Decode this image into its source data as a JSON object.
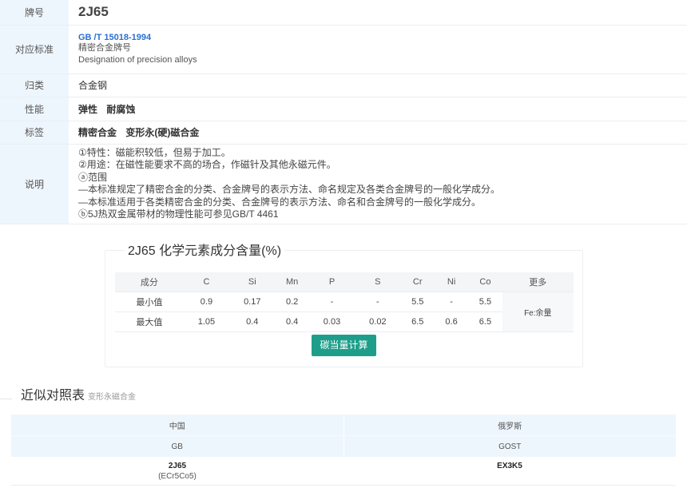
{
  "info": {
    "rows": {
      "grade": {
        "label": "牌号",
        "value": "2J65"
      },
      "standard": {
        "label": "对应标准",
        "code": "GB /T 15018-1994",
        "name_cn": "精密合金牌号",
        "name_en": "Designation of precision alloys"
      },
      "category": {
        "label": "归类",
        "value": "合金钢"
      },
      "performance": {
        "label": "性能",
        "tags": [
          "弹性",
          "耐腐蚀"
        ]
      },
      "tags": {
        "label": "标签",
        "tags": [
          "精密合金",
          "变形永(硬)磁合金"
        ]
      },
      "description": {
        "label": "说明",
        "lines": [
          "①特性：磁能积较低，但易于加工。",
          "②用途：在磁性能要求不高的场合，作磁针及其他永磁元件。",
          "ⓐ范围",
          "—本标准规定了精密合金的分类、合金牌号的表示方法、命名规定及各类合金牌号的一般化学成分。",
          "—本标准适用于各类精密合金的分类、合金牌号的表示方法、命名和合金牌号的一般化学成分。",
          "ⓑ5J热双金属带材的物理性能可参见GB/T 4461"
        ]
      }
    }
  },
  "composition": {
    "title": "2J65 化学元素成分含量(%)",
    "headers": [
      "成分",
      "C",
      "Si",
      "Mn",
      "P",
      "S",
      "Cr",
      "Ni",
      "Co",
      "更多"
    ],
    "min_row": [
      "最小值",
      "0.9",
      "0.17",
      "0.2",
      "-",
      "-",
      "5.5",
      "-",
      "5.5"
    ],
    "max_row": [
      "最大值",
      "1.05",
      "0.4",
      "0.4",
      "0.03",
      "0.02",
      "6.5",
      "0.6",
      "6.5"
    ],
    "more_value": "Fe:余量",
    "button_label": "碳当量计算"
  },
  "cross_reference": {
    "title": "近似对照表",
    "subtitle": "变形永磁合金",
    "countries": [
      "中国",
      "俄罗斯"
    ],
    "standards": [
      "GB",
      "GOST"
    ],
    "grades": [
      {
        "name": "2J65",
        "alias": "(ECr5Co5)"
      },
      {
        "name": "EX3K5",
        "alias": ""
      }
    ]
  },
  "colors": {
    "accent": "#1e9e8a",
    "link": "#2a6fd4",
    "label_bg": "#eef6fd"
  }
}
